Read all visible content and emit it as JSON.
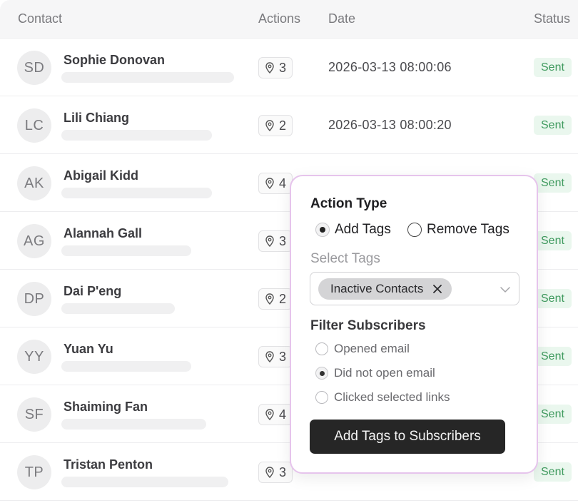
{
  "table": {
    "headers": {
      "contact": "Contact",
      "actions": "Actions",
      "date": "Date",
      "status": "Status"
    },
    "rows": [
      {
        "initials": "SD",
        "name": "Sophie Donovan",
        "actions": "3",
        "date": "2026-03-13 08:00:06",
        "status": "Sent"
      },
      {
        "initials": "LC",
        "name": "Lili Chiang",
        "actions": "2",
        "date": "2026-03-13 08:00:20",
        "status": "Sent"
      },
      {
        "initials": "AK",
        "name": "Abigail Kidd",
        "actions": "4",
        "date": "",
        "status": "Sent"
      },
      {
        "initials": "AG",
        "name": "Alannah Gall",
        "actions": "3",
        "date": "",
        "status": "Sent"
      },
      {
        "initials": "DP",
        "name": "Dai P'eng",
        "actions": "2",
        "date": "",
        "status": "Sent"
      },
      {
        "initials": "YY",
        "name": "Yuan Yu",
        "actions": "3",
        "date": "",
        "status": "Sent"
      },
      {
        "initials": "SF",
        "name": "Shaiming Fan",
        "actions": "4",
        "date": "",
        "status": "Sent"
      },
      {
        "initials": "TP",
        "name": "Tristan Penton",
        "actions": "3",
        "date": "",
        "status": "Sent"
      }
    ]
  },
  "popover": {
    "action_type_title": "Action Type",
    "action_options": [
      {
        "label": "Add Tags",
        "selected": true
      },
      {
        "label": "Remove Tags",
        "selected": false
      }
    ],
    "select_tags_label": "Select Tags",
    "selected_tag": "Inactive Contacts",
    "filter_title": "Filter Subscribers",
    "filter_options": [
      {
        "label": "Opened email",
        "selected": false
      },
      {
        "label": "Did not open email",
        "selected": true
      },
      {
        "label": "Clicked selected links",
        "selected": false
      }
    ],
    "submit_label": "Add Tags to Subscribers"
  },
  "colors": {
    "status_bg": "#eaf7ee",
    "status_text": "#3f9a5e",
    "popover_border": "#e6c4ec",
    "cta_bg": "#262626"
  }
}
